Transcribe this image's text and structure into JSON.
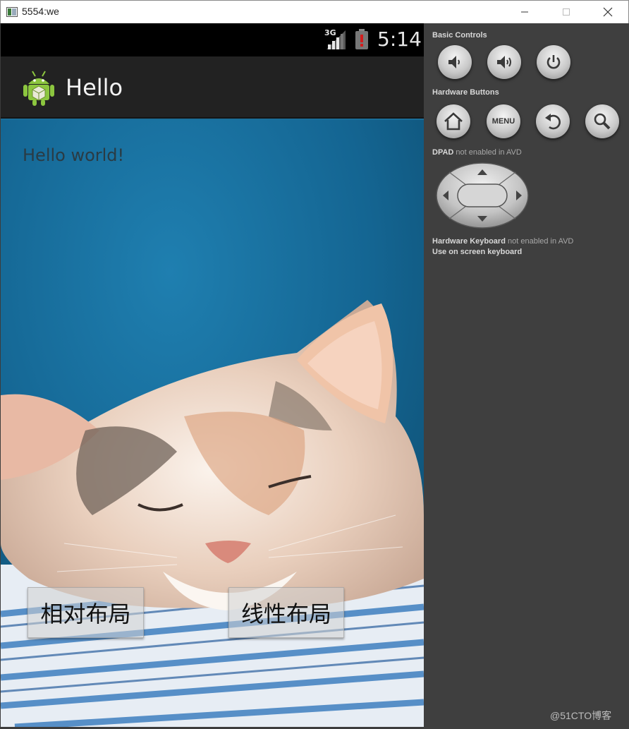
{
  "window": {
    "title": "5554:we",
    "controls": [
      "minimize",
      "maximize",
      "close"
    ]
  },
  "phone": {
    "status_bar": {
      "network": "3G",
      "time": "5:14"
    },
    "action_bar": {
      "title": "Hello",
      "icon": "android-robot-icon"
    },
    "content": {
      "text": "Hello world!",
      "background": "sleeping-cat-photo",
      "buttons": [
        {
          "label": "相对布局"
        },
        {
          "label": "线性布局"
        }
      ]
    }
  },
  "control_panel": {
    "basic_controls": {
      "label": "Basic Controls",
      "buttons": [
        "volume-down-icon",
        "volume-up-icon",
        "power-icon"
      ]
    },
    "hardware_buttons": {
      "label": "Hardware Buttons",
      "buttons": [
        "home-icon",
        "menu",
        "back-icon",
        "search-icon"
      ],
      "menu_label": "MENU"
    },
    "dpad": {
      "label": "DPAD",
      "note": "not enabled in AVD"
    },
    "keyboard": {
      "label": "Hardware Keyboard",
      "note": "not enabled in AVD",
      "line2": "Use on screen keyboard"
    }
  },
  "watermark": "@51CTO博客",
  "colors": {
    "status_bar": "#000000",
    "action_bar": "#222222",
    "panel": "#3f3f3f",
    "screen_bg": "#1a6e99"
  }
}
